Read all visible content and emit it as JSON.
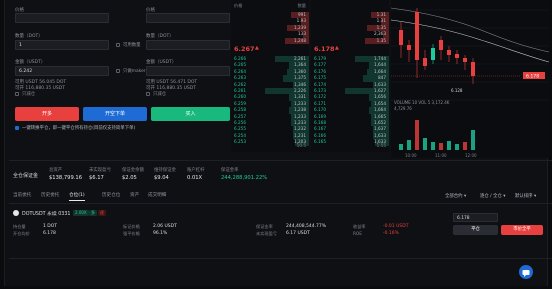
{
  "form": {
    "left_price_label": "价格",
    "left_price_value": "",
    "right_price_label": "价格",
    "right_price_value": "",
    "left_qty_label": "数量（DOT）",
    "left_qty_value": "1",
    "right_qty_label": "数量（DOT）",
    "right_qty_value": "",
    "left_qty_check": "可用数量",
    "right_qty_check": "可用数量",
    "left_amount_label": "金额（USDT）",
    "left_amount_value": "6.242",
    "right_amount_label": "金额（USDT）",
    "right_amount_value": "",
    "left_amount_check": "只做maker",
    "right_amount_check": "只做maker",
    "left_avail": "可用 USDT  56.045 DOT",
    "right_avail": "可用 USDT  56.471 DOT",
    "left_max": "可开 116,880.35 USDT",
    "right_max": "可开 116,880.35 USDT",
    "left_option": "只减仓",
    "right_option": "只减仓",
    "buy_label": "开多",
    "sell_label": "开空下单",
    "green_label": "买入",
    "note": "一键转换平仓，即一键平仓所有持仓(目前仅支持简单下单)"
  },
  "book_left": {
    "header_price": "价格",
    "header_size": "数量",
    "asks": [
      {
        "p": "",
        "s": "991"
      },
      {
        "p": "",
        "s": "1.93"
      },
      {
        "p": "",
        "s": "1,239"
      },
      {
        "p": "",
        "s": "133"
      },
      {
        "p": "",
        "s": "1,248"
      }
    ],
    "mid_price": "6.267",
    "mid_arrow": "▲",
    "bids": [
      {
        "p": "6.266",
        "s": "2,261"
      },
      {
        "p": "6.265",
        "s": "1,364"
      },
      {
        "p": "6.264",
        "s": "1,360"
      },
      {
        "p": "6.263",
        "s": "1,375"
      },
      {
        "p": "6.262",
        "s": "1,346"
      },
      {
        "p": "6.261",
        "s": "2,226"
      },
      {
        "p": "6.260",
        "s": "1,331"
      },
      {
        "p": "6.259",
        "s": "1,233"
      },
      {
        "p": "6.258",
        "s": "1,238"
      },
      {
        "p": "6.257",
        "s": "1,233"
      },
      {
        "p": "6.256",
        "s": "1,233"
      },
      {
        "p": "6.255",
        "s": "1,232"
      },
      {
        "p": "6.254",
        "s": "1,231"
      },
      {
        "p": "6.253",
        "s": "1,203"
      }
    ],
    "footer": "10.5"
  },
  "book_right": {
    "asks": [
      {
        "p": "",
        "s": "1.31"
      },
      {
        "p": "",
        "s": "1.31"
      },
      {
        "p": "",
        "s": "1.35"
      },
      {
        "p": "",
        "s": "2,363"
      },
      {
        "p": "",
        "s": "1.35"
      }
    ],
    "mid_price": "6.178",
    "mid_arrow": "▲",
    "bids": [
      {
        "p": "6.179",
        "s": "1,744"
      },
      {
        "p": "6.177",
        "s": "1,644"
      },
      {
        "p": "6.176",
        "s": "1,664"
      },
      {
        "p": "6.175",
        "s": "847"
      },
      {
        "p": "6.174",
        "s": "1,633"
      },
      {
        "p": "6.173",
        "s": "1,627"
      },
      {
        "p": "6.172",
        "s": "1,656"
      },
      {
        "p": "6.171",
        "s": "1,654"
      },
      {
        "p": "6.170",
        "s": "1,664"
      },
      {
        "p": "6.169",
        "s": "1,665"
      },
      {
        "p": "6.168",
        "s": "1,652"
      },
      {
        "p": "6.167",
        "s": "1,637"
      },
      {
        "p": "6.166",
        "s": "1,633"
      },
      {
        "p": "6.165",
        "s": "1,633"
      }
    ],
    "footer": "1.55"
  },
  "chart": {
    "price_tag": "6.178",
    "low_tag": "6.128",
    "volume_label": "VOLUME 10  VOL 5  3,172.4K",
    "vol_left": "4,729.76",
    "x_ticks": [
      "10:00",
      "11:00",
      "12:00"
    ],
    "colors": {
      "up": "#1ec99a",
      "down": "#e8403f"
    }
  },
  "account": {
    "title": "全仓保证金",
    "items": [
      {
        "t": "总资产",
        "v": "$138,799.16"
      },
      {
        "t": "未实现盈亏",
        "v": "$6.17"
      },
      {
        "t": "保证金余额",
        "v": "$2.05"
      },
      {
        "t": "维持保证金",
        "v": "$9.04"
      },
      {
        "t": "账户杠杆",
        "v": "0.01X"
      },
      {
        "t": "保证金率",
        "v": "244,288,901.22%"
      }
    ]
  },
  "tabs": [
    "当前委托",
    "历史委托",
    "仓位(1)",
    "历史仓位",
    "资产",
    "成交明细"
  ],
  "tab_active_index": 2,
  "selectors": [
    "全部合约",
    "逐仓 / 全仓",
    "默认排序"
  ],
  "position": {
    "symbol": "DOTUSDT 永续 0331",
    "leverage_tag": "2.00X",
    "side_tag": "多",
    "cross_tag": "逐",
    "fields": [
      {
        "t": "持仓量",
        "v": "1 DOT"
      },
      {
        "t": "开仓均价",
        "v": "6.178"
      },
      {
        "t": "标记价格",
        "v": "2.06 USDT"
      },
      {
        "t": "强平价格",
        "v": "96.1%"
      },
      {
        "t": "保证金率",
        "v": "244,408,544.77%"
      },
      {
        "t": "未实现盈亏",
        "v": "6.17 USDT"
      },
      {
        "t": "收益率",
        "v": "-0.01 USDT"
      },
      {
        "t": "ROE",
        "v": "-0.16%"
      }
    ],
    "input_price": "6.178",
    "close_btn": "平仓",
    "market_btn": "市价全平"
  }
}
